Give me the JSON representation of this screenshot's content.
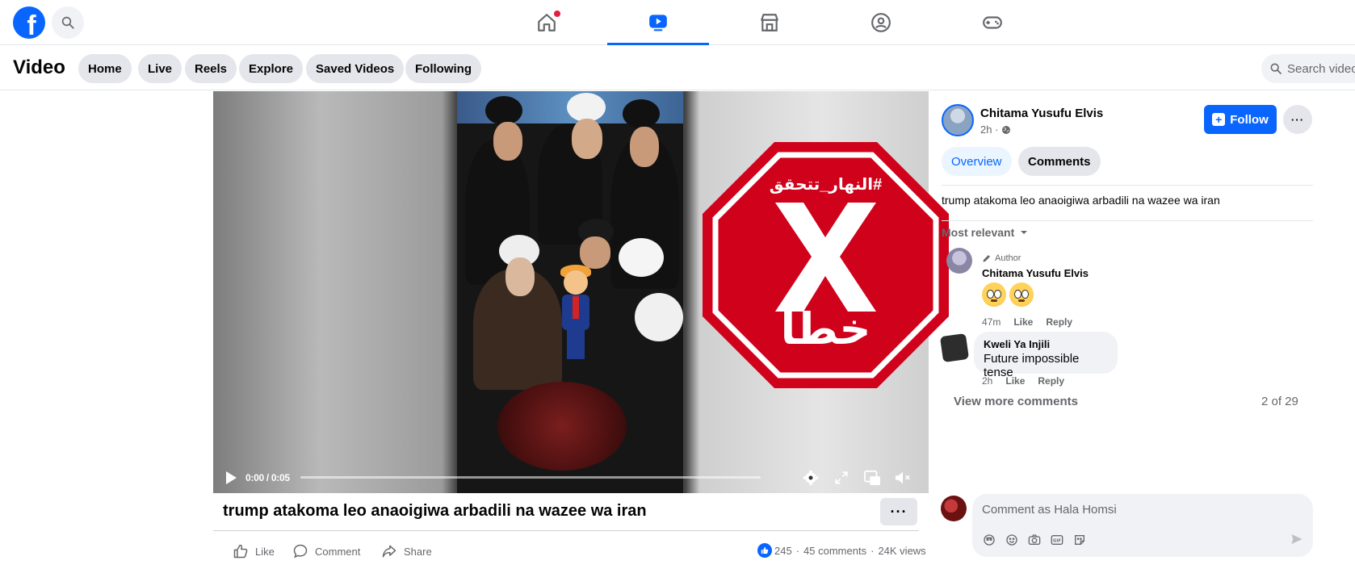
{
  "topnav": {
    "logo": "f",
    "tabs": [
      {
        "name": "home-icon",
        "active": false
      },
      {
        "name": "video-icon",
        "active": true
      },
      {
        "name": "marketplace-icon",
        "active": false
      },
      {
        "name": "groups-icon",
        "active": false
      },
      {
        "name": "gaming-icon",
        "active": false
      }
    ],
    "accent": "#0866ff"
  },
  "subheader": {
    "title": "Video",
    "pills": [
      "Home",
      "Live",
      "Reels",
      "Explore",
      "Saved Videos",
      "Following"
    ],
    "search_placeholder": "Search videos"
  },
  "video": {
    "overlay_hashtag": "#النهار_تتحقق",
    "overlay_label": "خطأ",
    "time": "0:00 / 0:05",
    "progress": 0,
    "title": "trump atakoma leo anaoigiwa arbadili na wazee wa iran"
  },
  "actions": {
    "like": "Like",
    "comment": "Comment",
    "share": "Share",
    "reactions": "245",
    "comments_count": "45 comments",
    "views": "24K views"
  },
  "panel": {
    "author": "Chitama Yusufu Elvis",
    "time": "2h ·",
    "follow": "Follow",
    "tabs": [
      "Overview",
      "Comments"
    ],
    "description": "trump atakoma leo anaoigiwa arbadili na wazee wa iran",
    "sort": "Most relevant",
    "comments": [
      {
        "badge": "Author",
        "name": "Chitama Yusufu Elvis",
        "time": "47m",
        "like": "Like",
        "reply": "Reply"
      },
      {
        "name": "Kweli Ya Injili",
        "text": "Future impossible tense",
        "time": "2h",
        "like": "Like",
        "reply": "Reply"
      }
    ],
    "view_more": "View more comments",
    "count": "2 of 29",
    "comment_placeholder": "Comment as Hala Homsi"
  }
}
